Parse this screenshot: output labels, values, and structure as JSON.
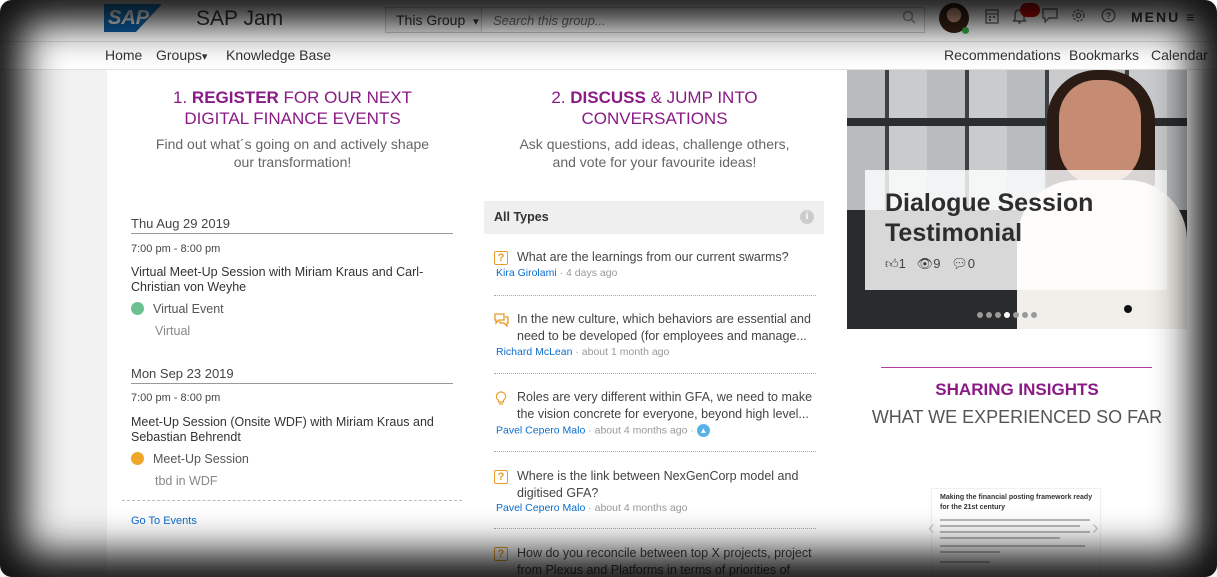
{
  "app": {
    "brand": "SAP",
    "title": "SAP Jam"
  },
  "search": {
    "scope": "This Group",
    "scope_caret": "▾",
    "placeholder": "Search this group..."
  },
  "toolbar": {
    "notifications_badge": "",
    "menu_label": "MENU ≡"
  },
  "nav": {
    "left": [
      {
        "label": "Home"
      },
      {
        "label": "Groups"
      },
      {
        "label": "Knowledge Base"
      }
    ],
    "groups_caret": "▾",
    "right": [
      {
        "label": "Recommendations"
      },
      {
        "label": "Bookmarks"
      },
      {
        "label": "Calendar"
      }
    ]
  },
  "register": {
    "number": "1.",
    "keyword": "REGISTER",
    "rest1": " FOR OUR NEXT",
    "line2": "DIGITAL FINANCE EVENTS",
    "sub1": "Find out what´s going on and actively shape",
    "sub2": "our transformation!"
  },
  "discuss": {
    "number": "2.",
    "keyword": "DISCUSS",
    "rest1": " & JUMP INTO",
    "line2": "CONVERSATIONS",
    "sub1": "Ask questions, add ideas, challenge others,",
    "sub2": "and vote for your favourite ideas!"
  },
  "events": [
    {
      "date": "Thu Aug 29 2019",
      "time": "7:00 pm - 8:00 pm",
      "title": "Virtual Meet-Up Session with Miriam Kraus and Carl-Christian von Weyhe",
      "type": "Virtual Event",
      "type_color": "#6cc191",
      "location": "Virtual"
    },
    {
      "date": "Mon Sep 23 2019",
      "time": "7:00 pm - 8:00 pm",
      "title": "Meet-Up Session (Onsite WDF) with Miriam Kraus and Sebastian Behrendt",
      "type": "Meet-Up Session",
      "type_color": "#eea72b",
      "location": "tbd in WDF"
    }
  ],
  "go_to_events": "Go To Events",
  "feed": {
    "header": "All Types",
    "items": [
      {
        "icon": "question-icon",
        "text": "What are the learnings from our current swarms?",
        "author": "Kira Girolami",
        "time": " · 4 days ago"
      },
      {
        "icon": "discussion-icon",
        "text": "In the new culture, which behaviors are essential and need to be developed (for employees and manage...",
        "author": "Richard McLean",
        "time": " · about 1 month ago"
      },
      {
        "icon": "idea-icon",
        "text": "Roles are very different within GFA, we need to make the vision concrete for everyone, beyond high level...",
        "author": "Pavel Cepero Malo",
        "time": " · about 4 months ago · "
      },
      {
        "icon": "question-icon",
        "text": "Where is the link between NexGenCorp model and digitised GFA?",
        "author": "Pavel Cepero Malo",
        "time": " · about 4 months ago"
      },
      {
        "icon": "question-icon",
        "text": "How do you reconcile between top X projects, project from Plexus and Platforms in terms of priorities of the...",
        "author": "",
        "time": ""
      }
    ]
  },
  "video": {
    "title": "Dialogue Session Testimonial",
    "likes": "1",
    "views": "9",
    "comments": "0"
  },
  "insights": {
    "title": "SHARING INSIGHTS",
    "subtitle": "WHAT WE EXPERIENCED SO FAR",
    "doc_title": "Making the financial posting framework ready for the 21st century"
  }
}
